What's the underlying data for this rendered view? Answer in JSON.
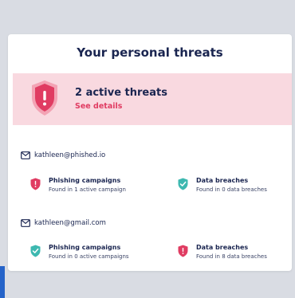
{
  "card": {
    "title": "Your personal threats"
  },
  "banner": {
    "count_text": "2 active threats",
    "link_text": "See details"
  },
  "accounts": [
    {
      "email": "kathleen@phished.io",
      "phishing": {
        "title": "Phishing campaigns",
        "detail": "Found in 1 active campaign",
        "status": "danger"
      },
      "breaches": {
        "title": "Data breaches",
        "detail": "Found in 0 data breaches",
        "status": "safe"
      }
    },
    {
      "email": "kathleen@gmail.com",
      "phishing": {
        "title": "Phishing campaigns",
        "detail": "Found in 0 active campaigns",
        "status": "safe"
      },
      "breaches": {
        "title": "Data breaches",
        "detail": "Found in 8 data breaches",
        "status": "danger"
      }
    }
  ],
  "colors": {
    "danger": "#e03c62",
    "safe": "#3db8b0",
    "banner_bg": "#f9d9e0",
    "text": "#1a2550"
  }
}
